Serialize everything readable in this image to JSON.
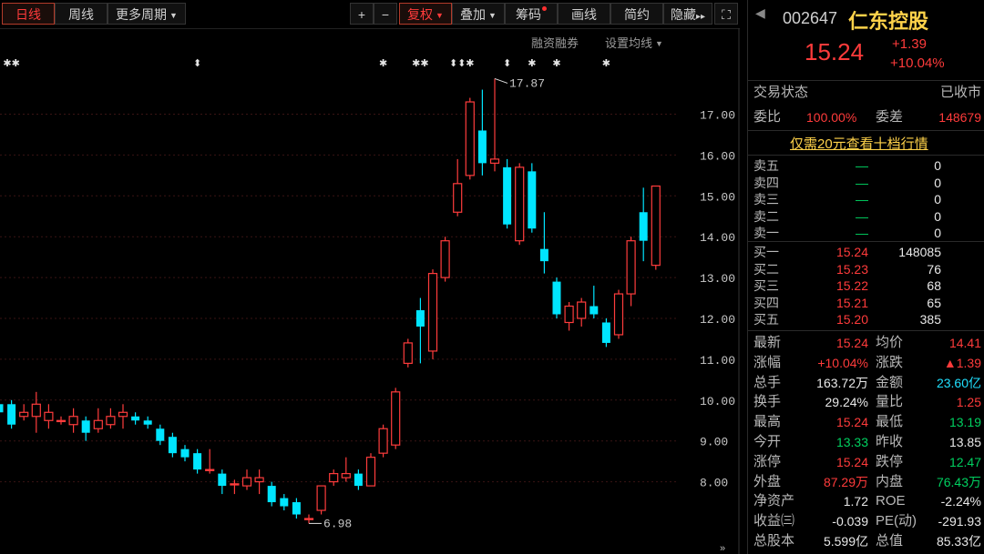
{
  "toolbar": {
    "buttons": [
      "日线",
      "周线",
      "更多周期",
      "+",
      "−",
      "复权",
      "叠加",
      "筹码",
      "画线",
      "简约",
      "隐藏"
    ],
    "more_period_caret": "▼",
    "fuquan_caret": "▼",
    "diejia_caret": "▼",
    "hide_arrows": "▸▸",
    "fullscreen_icon": "⛶",
    "sub_left": "融资融券",
    "sub_right": "设置均线",
    "sub_right_caret": "▼"
  },
  "chart": {
    "y_labels": [
      "17.00",
      "16.00",
      "15.00",
      "14.00",
      "13.00",
      "12.00",
      "11.00",
      "10.00",
      "9.00",
      "8.00"
    ],
    "high_label": "17.87",
    "low_label": "6.98",
    "colors": {
      "up": "#ff3c3c",
      "down": "#00e5ff",
      "grid": "#3a1414"
    },
    "candles": [
      {
        "o": 9.9,
        "c": 9.7,
        "h": 10.1,
        "l": 9.6
      },
      {
        "o": 9.9,
        "c": 9.4,
        "h": 10.0,
        "l": 9.3
      },
      {
        "o": 9.6,
        "c": 9.7,
        "h": 9.9,
        "l": 9.5
      },
      {
        "o": 9.6,
        "c": 9.9,
        "h": 10.2,
        "l": 9.2
      },
      {
        "o": 9.5,
        "c": 9.7,
        "h": 9.9,
        "l": 9.3
      },
      {
        "o": 9.5,
        "c": 9.5,
        "h": 9.6,
        "l": 9.4
      },
      {
        "o": 9.4,
        "c": 9.6,
        "h": 9.8,
        "l": 9.2
      },
      {
        "o": 9.5,
        "c": 9.2,
        "h": 9.6,
        "l": 9.0
      },
      {
        "o": 9.3,
        "c": 9.5,
        "h": 9.8,
        "l": 9.2
      },
      {
        "o": 9.4,
        "c": 9.6,
        "h": 9.8,
        "l": 9.3
      },
      {
        "o": 9.6,
        "c": 9.7,
        "h": 9.9,
        "l": 9.3
      },
      {
        "o": 9.6,
        "c": 9.5,
        "h": 9.7,
        "l": 9.4
      },
      {
        "o": 9.5,
        "c": 9.4,
        "h": 9.6,
        "l": 9.3
      },
      {
        "o": 9.3,
        "c": 9.0,
        "h": 9.4,
        "l": 8.9
      },
      {
        "o": 9.1,
        "c": 8.7,
        "h": 9.2,
        "l": 8.6
      },
      {
        "o": 8.8,
        "c": 8.6,
        "h": 8.9,
        "l": 8.5
      },
      {
        "o": 8.7,
        "c": 8.3,
        "h": 8.8,
        "l": 8.2
      },
      {
        "o": 8.3,
        "c": 8.3,
        "h": 8.8,
        "l": 8.2
      },
      {
        "o": 8.2,
        "c": 7.9,
        "h": 8.3,
        "l": 7.7
      },
      {
        "o": 7.95,
        "c": 7.95,
        "h": 8.05,
        "l": 7.7
      },
      {
        "o": 7.9,
        "c": 8.1,
        "h": 8.3,
        "l": 7.8
      },
      {
        "o": 8.0,
        "c": 8.1,
        "h": 8.3,
        "l": 7.7
      },
      {
        "o": 7.9,
        "c": 7.5,
        "h": 8.0,
        "l": 7.4
      },
      {
        "o": 7.6,
        "c": 7.4,
        "h": 7.7,
        "l": 7.3
      },
      {
        "o": 7.5,
        "c": 7.2,
        "h": 7.6,
        "l": 7.1
      },
      {
        "o": 7.1,
        "c": 7.1,
        "h": 7.2,
        "l": 6.98
      },
      {
        "o": 7.3,
        "c": 7.9,
        "h": 7.4,
        "l": 7.2
      },
      {
        "o": 8.0,
        "c": 8.2,
        "h": 8.3,
        "l": 7.9
      },
      {
        "o": 8.1,
        "c": 8.2,
        "h": 8.6,
        "l": 8.0
      },
      {
        "o": 8.2,
        "c": 7.9,
        "h": 8.3,
        "l": 7.8
      },
      {
        "o": 7.9,
        "c": 8.6,
        "h": 8.7,
        "l": 7.9
      },
      {
        "o": 8.7,
        "c": 9.3,
        "h": 9.4,
        "l": 8.6
      },
      {
        "o": 8.9,
        "c": 10.2,
        "h": 10.3,
        "l": 8.8
      },
      {
        "o": 10.9,
        "c": 11.4,
        "h": 11.5,
        "l": 10.8
      },
      {
        "o": 12.2,
        "c": 11.8,
        "h": 12.5,
        "l": 10.9
      },
      {
        "o": 11.2,
        "c": 13.1,
        "h": 13.2,
        "l": 11.0
      },
      {
        "o": 13.0,
        "c": 13.9,
        "h": 14.0,
        "l": 12.9
      },
      {
        "o": 14.6,
        "c": 15.3,
        "h": 15.9,
        "l": 14.5
      },
      {
        "o": 15.5,
        "c": 17.3,
        "h": 17.4,
        "l": 15.4
      },
      {
        "o": 16.6,
        "c": 15.8,
        "h": 17.6,
        "l": 15.5
      },
      {
        "o": 15.8,
        "c": 15.9,
        "h": 17.87,
        "l": 15.6
      },
      {
        "o": 15.7,
        "c": 14.3,
        "h": 15.9,
        "l": 14.2
      },
      {
        "o": 13.9,
        "c": 15.7,
        "h": 15.8,
        "l": 13.8
      },
      {
        "o": 15.6,
        "c": 14.2,
        "h": 15.8,
        "l": 14.1
      },
      {
        "o": 13.7,
        "c": 13.4,
        "h": 14.6,
        "l": 13.1
      },
      {
        "o": 12.9,
        "c": 12.1,
        "h": 13.0,
        "l": 12.0
      },
      {
        "o": 11.9,
        "c": 12.3,
        "h": 12.4,
        "l": 11.7
      },
      {
        "o": 12.0,
        "c": 12.4,
        "h": 12.5,
        "l": 11.8
      },
      {
        "o": 12.3,
        "c": 12.1,
        "h": 12.8,
        "l": 12.0
      },
      {
        "o": 11.9,
        "c": 11.4,
        "h": 12.0,
        "l": 11.3
      },
      {
        "o": 11.6,
        "c": 12.6,
        "h": 12.7,
        "l": 11.5
      },
      {
        "o": 12.6,
        "c": 13.9,
        "h": 14.0,
        "l": 12.3
      },
      {
        "o": 14.6,
        "c": 13.9,
        "h": 15.2,
        "l": 13.4
      },
      {
        "o": 13.3,
        "c": 15.24,
        "h": 15.24,
        "l": 13.19
      }
    ],
    "markers": [
      {
        "i": 1,
        "g": "✱✱"
      },
      {
        "i": 16,
        "g": "⬍"
      },
      {
        "i": 31,
        "g": "✱"
      },
      {
        "i": 34,
        "g": "✱✱"
      },
      {
        "i": 37,
        "g": "⬍⬍"
      },
      {
        "i": 38,
        "g": "✱"
      },
      {
        "i": 41,
        "g": "⬍"
      },
      {
        "i": 43,
        "g": "✱"
      },
      {
        "i": 45,
        "g": "✱"
      },
      {
        "i": 49,
        "g": "✱"
      }
    ]
  },
  "stock": {
    "code": "002647",
    "name": "仁东控股",
    "price": "15.24",
    "change": "+1.39",
    "pct": "+10.04%",
    "trade_status_label": "交易状态",
    "trade_status": "已收市",
    "weibi_label": "委比",
    "weibi": "100.00%",
    "weicha_label": "委差",
    "weicha": "148679",
    "promo": "仅需20元查看十档行情"
  },
  "orderbook": {
    "sell": [
      {
        "label": "卖五",
        "price": "—",
        "vol": "0"
      },
      {
        "label": "卖四",
        "price": "—",
        "vol": "0"
      },
      {
        "label": "卖三",
        "price": "—",
        "vol": "0"
      },
      {
        "label": "卖二",
        "price": "—",
        "vol": "0"
      },
      {
        "label": "卖一",
        "price": "—",
        "vol": "0"
      }
    ],
    "buy": [
      {
        "label": "买一",
        "price": "15.24",
        "vol": "148085"
      },
      {
        "label": "买二",
        "price": "15.23",
        "vol": "76"
      },
      {
        "label": "买三",
        "price": "15.22",
        "vol": "68"
      },
      {
        "label": "买四",
        "price": "15.21",
        "vol": "65"
      },
      {
        "label": "买五",
        "price": "15.20",
        "vol": "385"
      }
    ]
  },
  "quote": [
    {
      "l1": "最新",
      "v1": "15.24",
      "c1": "red",
      "l2": "均价",
      "v2": "14.41",
      "c2": "red"
    },
    {
      "l1": "涨幅",
      "v1": "+10.04%",
      "c1": "red",
      "l2": "涨跌",
      "v2": "▲1.39",
      "c2": "red"
    },
    {
      "l1": "总手",
      "v1": "163.72万",
      "c1": "white",
      "l2": "金额",
      "v2": "23.60亿",
      "c2": "cyan"
    },
    {
      "l1": "换手",
      "v1": "29.24%",
      "c1": "white",
      "l2": "量比",
      "v2": "1.25",
      "c2": "red"
    },
    {
      "l1": "最高",
      "v1": "15.24",
      "c1": "red",
      "l2": "最低",
      "v2": "13.19",
      "c2": "green"
    },
    {
      "l1": "今开",
      "v1": "13.33",
      "c1": "green",
      "l2": "昨收",
      "v2": "13.85",
      "c2": "white"
    },
    {
      "l1": "涨停",
      "v1": "15.24",
      "c1": "red",
      "l2": "跌停",
      "v2": "12.47",
      "c2": "green"
    },
    {
      "l1": "外盘",
      "v1": "87.29万",
      "c1": "red",
      "l2": "内盘",
      "v2": "76.43万",
      "c2": "green"
    },
    {
      "l1": "净资产",
      "v1": "1.72",
      "c1": "white",
      "l2": "ROE",
      "v2": "-2.24%",
      "c2": "white"
    },
    {
      "l1": "收益㈢",
      "v1": "-0.039",
      "c1": "white",
      "l2": "PE(动)",
      "v2": "-291.93",
      "c2": "white"
    },
    {
      "l1": "总股本",
      "v1": "5.599亿",
      "c1": "white",
      "l2": "总值",
      "v2": "85.33亿",
      "c2": "white"
    }
  ]
}
